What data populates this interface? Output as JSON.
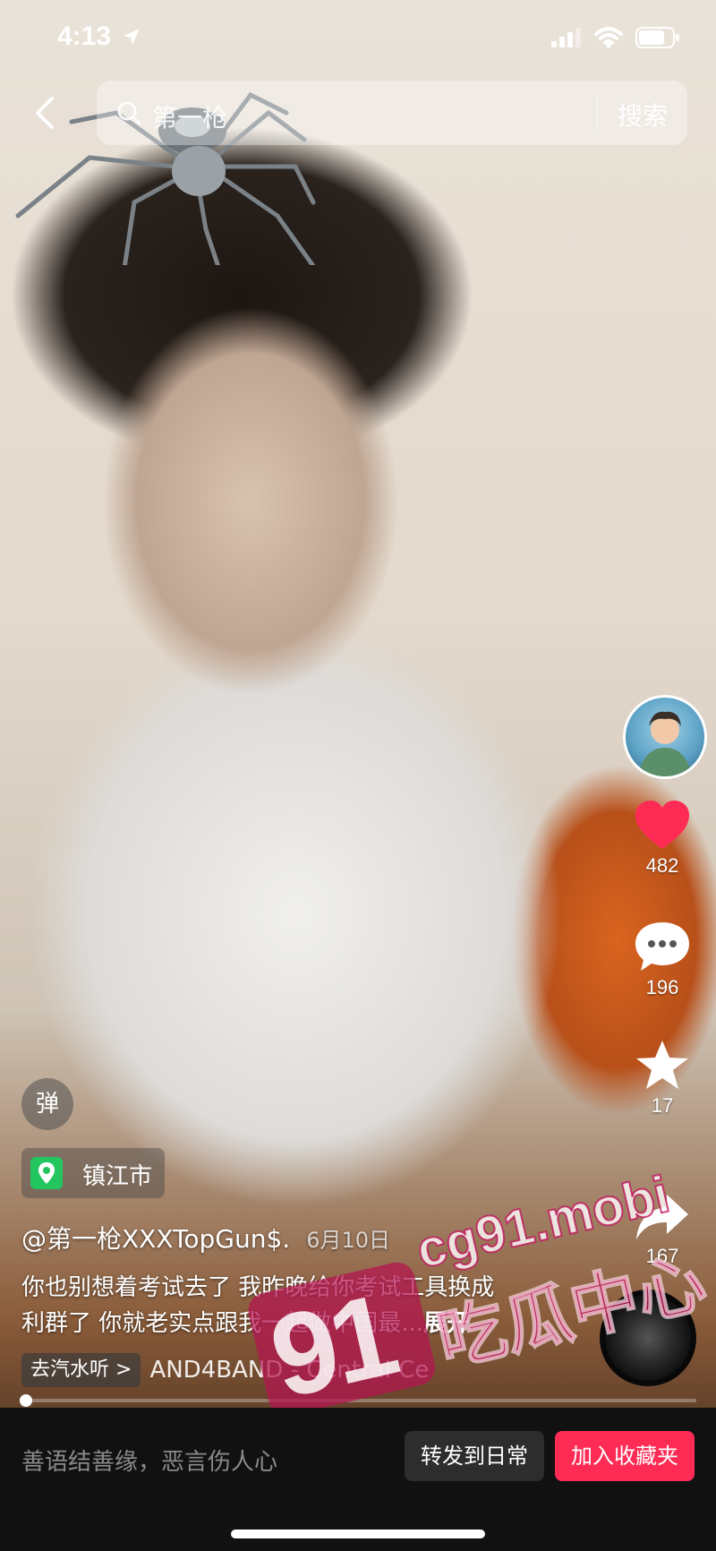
{
  "status_bar": {
    "time": "4:13",
    "icons": [
      "location-arrow-icon",
      "cellular-signal-icon",
      "wifi-icon",
      "battery-icon"
    ]
  },
  "search": {
    "query": "第一枪",
    "submit_label": "搜索"
  },
  "engagement": {
    "likes": "482",
    "comments": "196",
    "favorites": "17",
    "shares": "167",
    "like_color": "#fe2c55"
  },
  "danmu": {
    "label": "弹"
  },
  "location": {
    "label": "镇江市",
    "icon_color": "#22c55e"
  },
  "post": {
    "author": "@第一枪XXXTopGun$.",
    "date": "6月10日",
    "caption_line1": "你也别想着考试去了 我昨晚给你考试工具换成",
    "caption_line2": "利群了 你就老实点跟我一起做中国最",
    "caption_ellipsis": "...",
    "caption_expand": "展开"
  },
  "music": {
    "pill_label": "去汽水听 >",
    "track_text": "AND4BAND - Central Ce"
  },
  "playback": {
    "progress_fraction": 0.002
  },
  "bottom": {
    "comment_placeholder": "善语结善缘，恶言伤人心",
    "share_label": "转发到日常",
    "favorite_label": "加入收藏夹",
    "favorite_color": "#fe2c55"
  },
  "watermark": {
    "number": "91",
    "site": "cg91.mobi",
    "name": "吃瓜中心"
  }
}
